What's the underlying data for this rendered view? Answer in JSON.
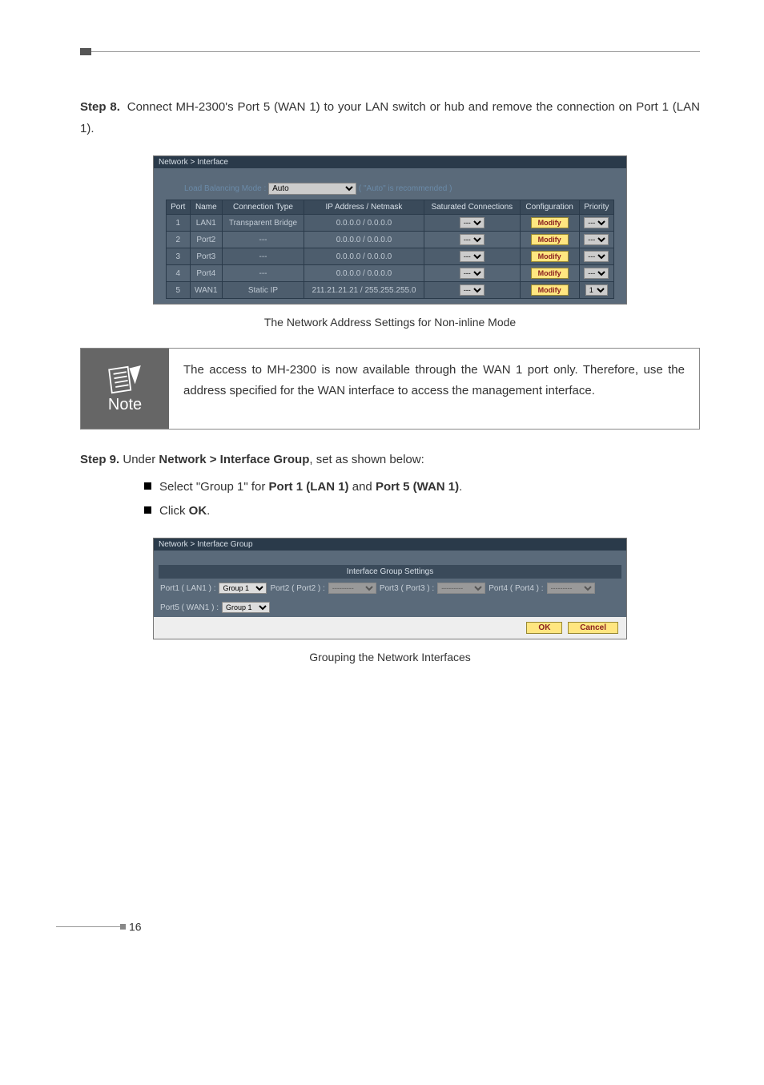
{
  "step8": {
    "label": "Step 8.",
    "text": "Connect MH-2300's Port 5 (WAN 1) to your LAN switch or hub and remove the connection on Port 1 (LAN 1)."
  },
  "screenshot1": {
    "breadcrumb": "Network > Interface",
    "lb_label": "Load Balancing Mode :",
    "lb_value": "Auto",
    "lb_hint": "( \"Auto\" is recommended )",
    "headers": {
      "port": "Port",
      "name": "Name",
      "ctype": "Connection Type",
      "ip": "IP Address / Netmask",
      "sat": "Saturated Connections",
      "conf": "Configuration",
      "prio": "Priority"
    },
    "rows": [
      {
        "port": "1",
        "name": "LAN1",
        "ctype": "Transparent Bridge",
        "ip": "0.0.0.0 / 0.0.0.0",
        "sat": "---",
        "conf": "Modify",
        "prio": "---"
      },
      {
        "port": "2",
        "name": "Port2",
        "ctype": "---",
        "ip": "0.0.0.0 / 0.0.0.0",
        "sat": "---",
        "conf": "Modify",
        "prio": "---"
      },
      {
        "port": "3",
        "name": "Port3",
        "ctype": "---",
        "ip": "0.0.0.0 / 0.0.0.0",
        "sat": "---",
        "conf": "Modify",
        "prio": "---"
      },
      {
        "port": "4",
        "name": "Port4",
        "ctype": "---",
        "ip": "0.0.0.0 / 0.0.0.0",
        "sat": "---",
        "conf": "Modify",
        "prio": "---"
      },
      {
        "port": "5",
        "name": "WAN1",
        "ctype": "Static IP",
        "ip": "211.21.21.21 / 255.255.255.0",
        "sat": "---",
        "conf": "Modify",
        "prio": "1"
      }
    ],
    "caption": "The Network Address Settings for Non-inline Mode"
  },
  "note": {
    "label": "Note",
    "text": "The access to MH-2300 is now available through the WAN 1 port only. Therefore, use the address specified for the WAN interface to access the management interface."
  },
  "step9": {
    "label": "Step 9.",
    "prefix": "Under ",
    "bold1": "Network > Interface Group",
    "suffix": ", set as shown below:",
    "b1_a": "Select \"Group 1\" for ",
    "b1_b": "Port 1 (LAN 1)",
    "b1_c": " and ",
    "b1_d": "Port 5 (WAN 1)",
    "b1_e": ".",
    "b2_a": "Click ",
    "b2_b": "OK",
    "b2_c": "."
  },
  "screenshot2": {
    "breadcrumb": "Network > Interface Group",
    "title": "Interface Group Settings",
    "p1_label": "Port1 ( LAN1 ) :",
    "p1_val": "Group 1",
    "p2_label": "Port2 ( Port2 ) :",
    "p2_val": "---------",
    "p3_label": "Port3 ( Port3 ) :",
    "p3_val": "---------",
    "p4_label": "Port4 ( Port4 ) :",
    "p4_val": "---------",
    "p5_label": "Port5 ( WAN1 ) :",
    "p5_val": "Group 1",
    "ok": "OK",
    "cancel": "Cancel",
    "caption": "Grouping the Network Interfaces"
  },
  "page_number": "16"
}
